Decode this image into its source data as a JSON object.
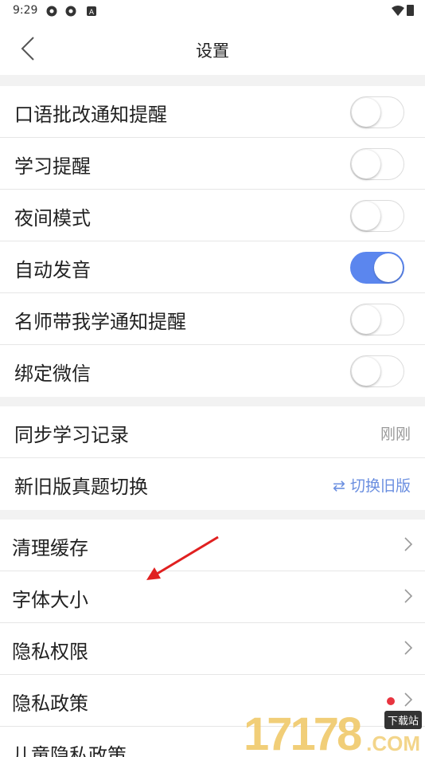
{
  "status_bar": {
    "time": "9:29"
  },
  "nav": {
    "title": "设置"
  },
  "section_toggles": [
    {
      "label": "口语批改通知提醒",
      "on": false
    },
    {
      "label": "学习提醒",
      "on": false
    },
    {
      "label": "夜间模式",
      "on": false
    },
    {
      "label": "自动发音",
      "on": true
    },
    {
      "label": "名师带我学通知提醒",
      "on": false
    },
    {
      "label": "绑定微信",
      "on": false
    }
  ],
  "section_values": [
    {
      "label": "同步学习记录",
      "value": "刚刚"
    },
    {
      "label": "新旧版真题切换",
      "value": "⇄ 切换旧版"
    }
  ],
  "section_links": [
    {
      "label": "清理缓存"
    },
    {
      "label": "字体大小"
    },
    {
      "label": "隐私权限"
    },
    {
      "label": "隐私政策"
    },
    {
      "label": "儿童隐私政策"
    }
  ],
  "watermark": {
    "digits": "17178",
    "tag": "下载站",
    "domain": ".COM"
  },
  "colors": {
    "accent": "#5b86ee",
    "red_dot": "#e8343f",
    "annotation_arrow": "#e02020"
  }
}
